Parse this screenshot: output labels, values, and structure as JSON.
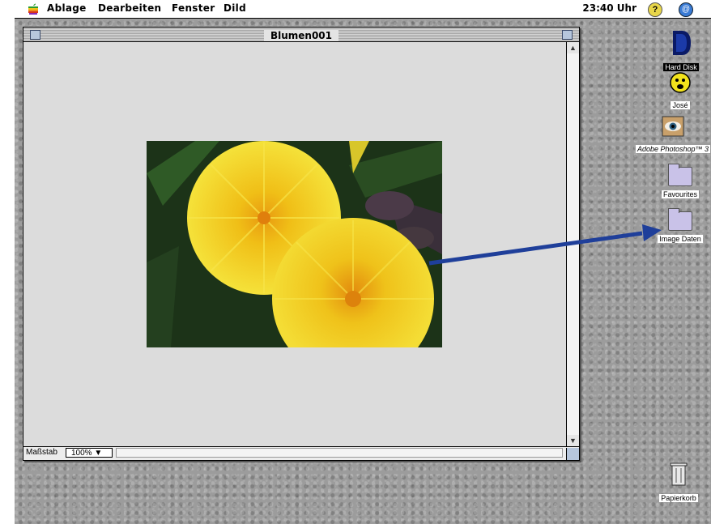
{
  "menubar": {
    "items": [
      "Ablage",
      "Dearbeiten",
      "Fenster",
      "Dild"
    ],
    "clock": "23:40 Uhr",
    "help_icon": "?",
    "app_icon": "@"
  },
  "window": {
    "title": "Blumen001",
    "scale_label": "Maßstab",
    "zoom_value": "100% ▼"
  },
  "desktop": {
    "icons": [
      {
        "label": "Hard Disk",
        "icon": "hard-disk-icon"
      },
      {
        "label": "José",
        "icon": "smiley-icon"
      },
      {
        "label": "Adobe Photoshop™ 3",
        "icon": "photoshop-eye-icon"
      },
      {
        "label": "Favourites",
        "icon": "folder-icon"
      },
      {
        "label": "Image Daten",
        "icon": "folder-icon"
      },
      {
        "label": "Papierkorb",
        "icon": "trash-icon"
      }
    ]
  },
  "colors": {
    "arrow": "#1f3f9a",
    "desktop": "#9c9c9c",
    "canvas": "#dcdcdc",
    "flower": "#f2d21c"
  }
}
